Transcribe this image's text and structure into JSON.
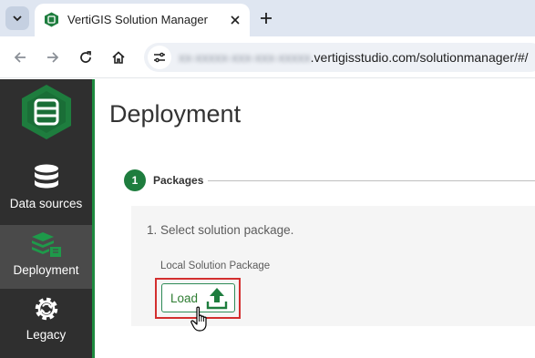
{
  "browser": {
    "tab": {
      "title": "VertiGIS Solution Manager"
    },
    "address_bar": {
      "url_blurred": "xx-xxxxx-xxx-xxx-xxxxx",
      "url_visible": ".vertigisstudio.com/solutionmanager/#/"
    }
  },
  "sidebar": {
    "items": [
      {
        "label": "Data sources",
        "icon": "database-icon",
        "active": false
      },
      {
        "label": "Deployment",
        "icon": "deployment-icon",
        "active": true
      },
      {
        "label": "Legacy",
        "icon": "legacy-gear-icon",
        "active": false
      }
    ]
  },
  "main": {
    "title": "Deployment",
    "stepper": {
      "number": "1",
      "label": "Packages"
    },
    "panel": {
      "instruction": "1. Select solution package.",
      "field_label": "Local Solution Package",
      "load_button_label": "Load"
    }
  },
  "colors": {
    "brand_green": "#1e7d3e",
    "sidebar_bg": "#2f2f2f",
    "highlight_red": "#d32f2f"
  }
}
